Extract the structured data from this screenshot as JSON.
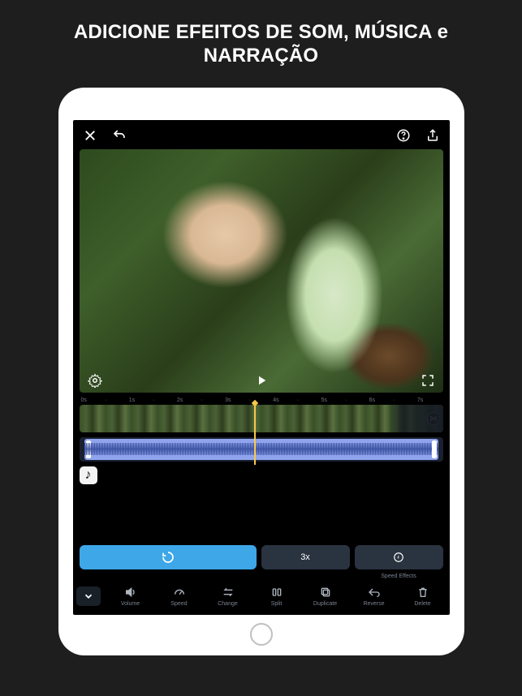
{
  "headline_line1": "ADICIONE EFEITOS DE SOM, MÚSICA e",
  "headline_line2": "NARRAÇÃO",
  "ruler": [
    "0s",
    "·",
    "1s",
    "·",
    "2s",
    "·",
    "3s",
    "·",
    "4s",
    "·",
    "5s",
    "·",
    "6s",
    "·",
    "7s"
  ],
  "clip_music_symbol": "♪",
  "speed": {
    "reset_icon": "↺",
    "multiplier": "3x",
    "effects_icon": "⚡",
    "effects_label": "Speed Effects"
  },
  "tools": [
    {
      "key": "volume",
      "label": "Volume"
    },
    {
      "key": "speed",
      "label": "Speed"
    },
    {
      "key": "change",
      "label": "Change"
    },
    {
      "key": "split",
      "label": "Split"
    },
    {
      "key": "duplicate",
      "label": "Duplicate"
    },
    {
      "key": "reverse",
      "label": "Reverse"
    },
    {
      "key": "delete",
      "label": "Delete"
    }
  ]
}
